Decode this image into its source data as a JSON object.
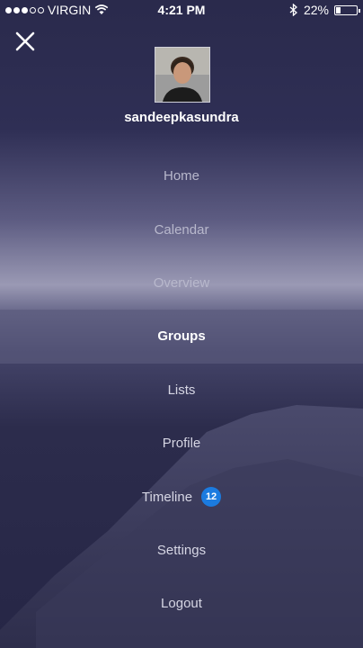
{
  "status_bar": {
    "carrier": "VIRGIN",
    "time": "4:21 PM",
    "battery": "22%",
    "battery_level": 0.22
  },
  "profile": {
    "username": "sandeepkasundra"
  },
  "menu": {
    "items": [
      {
        "label": "Home"
      },
      {
        "label": "Calendar"
      },
      {
        "label": "Overview"
      },
      {
        "label": "Groups"
      },
      {
        "label": "Lists"
      },
      {
        "label": "Profile"
      },
      {
        "label": "Timeline",
        "badge": "12"
      },
      {
        "label": "Settings"
      },
      {
        "label": "Logout"
      }
    ]
  },
  "colors": {
    "badge": "#1b7be0",
    "active_row": "#5a5a7d"
  },
  "icons": {
    "close": "close-icon",
    "wifi": "wifi-icon",
    "bluetooth": "bluetooth-icon",
    "battery": "battery-icon"
  }
}
